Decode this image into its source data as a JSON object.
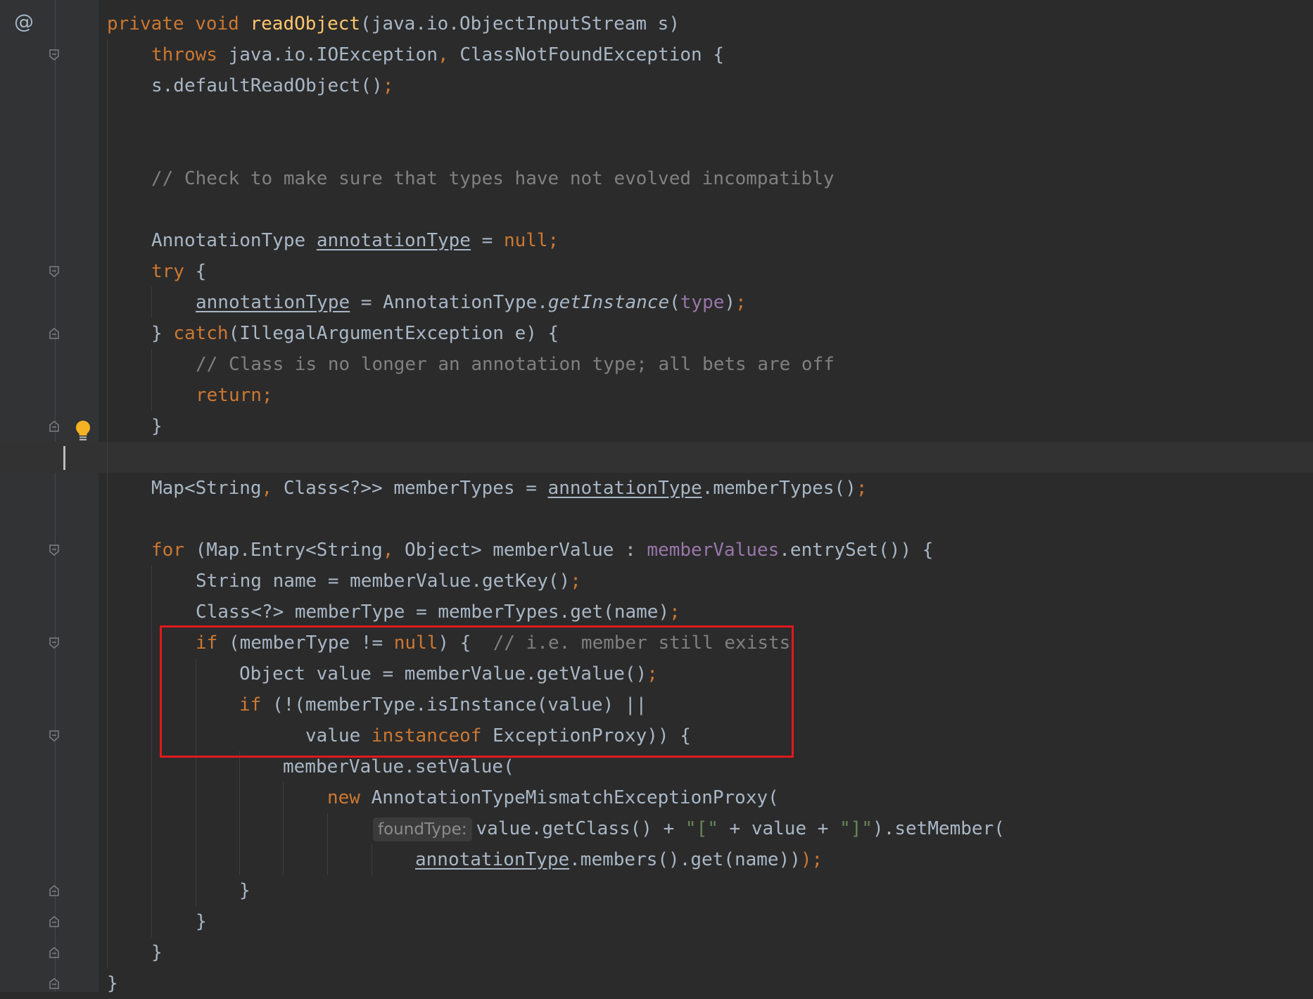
{
  "gutter": {
    "annotation_marker": "@"
  },
  "colors": {
    "background": "#2b2b2b",
    "keyword": "#cc7832",
    "method_declaration": "#ffc66d",
    "comment": "#808080",
    "field": "#9876aa",
    "string": "#6a8759",
    "default_text": "#a9b7c6",
    "highlight_box": "#e1191c"
  },
  "code": {
    "lines": [
      [
        {
          "t": "private void ",
          "s": "kw"
        },
        {
          "t": "readObject",
          "s": "fn"
        },
        {
          "t": "(java.io.ObjectInputStream s)"
        }
      ],
      [
        {
          "t": "throws ",
          "s": "kw"
        },
        {
          "t": "java.io.IOException"
        },
        {
          "t": ", ",
          "s": "kw"
        },
        {
          "t": "ClassNotFoundException {"
        }
      ],
      [
        {
          "t": "s.defaultReadObject()"
        },
        {
          "t": ";",
          "s": "kw"
        }
      ],
      [],
      [],
      [
        {
          "t": "// Check to make sure that types have not evolved incompatibly",
          "s": "com"
        }
      ],
      [],
      [
        {
          "t": "AnnotationType "
        },
        {
          "t": "annotationType",
          "s": "u"
        },
        {
          "t": " = "
        },
        {
          "t": "null;",
          "s": "kw"
        }
      ],
      [
        {
          "t": "try ",
          "s": "kw"
        },
        {
          "t": "{"
        }
      ],
      [
        {
          "t": "annotationType",
          "s": "u"
        },
        {
          "t": " = AnnotationType."
        },
        {
          "t": "getInstance",
          "s": "it"
        },
        {
          "t": "("
        },
        {
          "t": "type",
          "s": "field"
        },
        {
          "t": ")"
        },
        {
          "t": ";",
          "s": "kw"
        }
      ],
      [
        {
          "t": "} "
        },
        {
          "t": "catch",
          "s": "kw"
        },
        {
          "t": "(IllegalArgumentException e) {"
        }
      ],
      [
        {
          "t": "// Class is no longer an annotation type; all bets are off",
          "s": "com"
        }
      ],
      [
        {
          "t": "return;",
          "s": "kw"
        }
      ],
      [
        {
          "t": "}"
        }
      ],
      [],
      [
        {
          "t": "Map<String"
        },
        {
          "t": ", ",
          "s": "kw"
        },
        {
          "t": "Class<?>> memberTypes = "
        },
        {
          "t": "annotationType",
          "s": "u"
        },
        {
          "t": ".memberTypes()"
        },
        {
          "t": ";",
          "s": "kw"
        }
      ],
      [],
      [
        {
          "t": "for ",
          "s": "kw"
        },
        {
          "t": "(Map.Entry<String"
        },
        {
          "t": ", ",
          "s": "kw"
        },
        {
          "t": "Object> memberValue : "
        },
        {
          "t": "memberValues",
          "s": "field"
        },
        {
          "t": ".entrySet()) {"
        }
      ],
      [
        {
          "t": "String name = memberValue.getKey()"
        },
        {
          "t": ";",
          "s": "kw"
        }
      ],
      [
        {
          "t": "Class<?> memberType = memberTypes.get(name)"
        },
        {
          "t": ";",
          "s": "kw"
        }
      ],
      [
        {
          "t": "if ",
          "s": "kw"
        },
        {
          "t": "(memberType != "
        },
        {
          "t": "null",
          "s": "kw"
        },
        {
          "t": ") {  "
        },
        {
          "t": "// i.e. member still exists",
          "s": "com"
        }
      ],
      [
        {
          "t": "Object value = memberValue.getValue()"
        },
        {
          "t": ";",
          "s": "kw"
        }
      ],
      [
        {
          "t": "if ",
          "s": "kw"
        },
        {
          "t": "(!(memberType.isInstance(value) ||"
        }
      ],
      [
        {
          "t": "value "
        },
        {
          "t": "instanceof ",
          "s": "kw"
        },
        {
          "t": "ExceptionProxy)) {"
        }
      ],
      [
        {
          "t": "memberValue.setValue("
        }
      ],
      [
        {
          "t": "new ",
          "s": "kw"
        },
        {
          "t": "AnnotationTypeMismatchExceptionProxy("
        }
      ],
      [
        {
          "t": "foundType:",
          "s": "hint"
        },
        {
          "t": "value.getClass() + "
        },
        {
          "t": "\"[\"",
          "s": "str"
        },
        {
          "t": " + value + "
        },
        {
          "t": "\"]\"",
          "s": "str"
        },
        {
          "t": ").setMember("
        }
      ],
      [
        {
          "t": "annotationType",
          "s": "u"
        },
        {
          "t": ".members().get(name))"
        },
        {
          "t": ");",
          "s": "kw"
        }
      ],
      [
        {
          "t": "}"
        }
      ],
      [
        {
          "t": "}"
        }
      ],
      [
        {
          "t": "}"
        }
      ],
      [
        {
          "t": "}"
        }
      ]
    ]
  }
}
